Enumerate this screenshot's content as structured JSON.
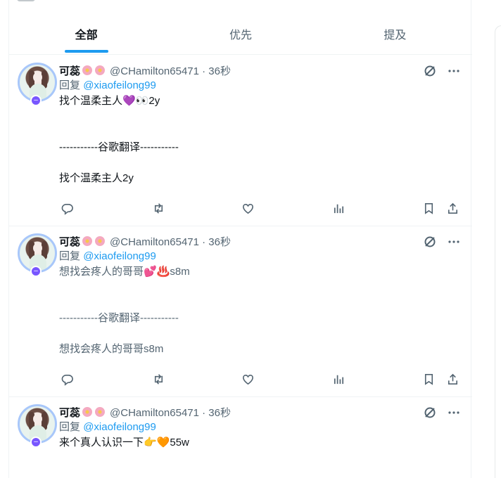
{
  "tabs": [
    {
      "label": "全部",
      "active": true
    },
    {
      "label": "优先",
      "active": false
    },
    {
      "label": "提及",
      "active": false
    }
  ],
  "tweets": [
    {
      "display_name": "可蕊",
      "handle_time": "@CHamilton65471 · 36秒",
      "reply_prefix": "回复",
      "reply_to": "@xiaofeilong99",
      "lines": [
        "找个温柔主人💜👀2y",
        "",
        "",
        "-----------谷歌翻译-----------",
        "",
        "找个温柔主人2y"
      ],
      "text_color": "dark"
    },
    {
      "display_name": "可蕊",
      "handle_time": "@CHamilton65471 · 36秒",
      "reply_prefix": "回复",
      "reply_to": "@xiaofeilong99",
      "lines": [
        "想找会疼人的哥哥💕♨️s8m",
        "",
        "",
        "-----------谷歌翻译-----------",
        "",
        "想找会疼人的哥哥s8m"
      ],
      "text_color": "muted"
    },
    {
      "display_name": "可蕊",
      "handle_time": "@CHamilton65471 · 36秒",
      "reply_prefix": "回复",
      "reply_to": "@xiaofeilong99",
      "lines": [
        "来个真人认识一下👉🧡55w"
      ],
      "text_color": "dark"
    }
  ],
  "icons": {
    "grok": "grok-icon",
    "more": "more-icon",
    "reply": "reply-icon",
    "repost": "repost-icon",
    "like": "like-icon",
    "views": "views-icon",
    "bookmark": "bookmark-icon",
    "share": "share-icon"
  },
  "colors": {
    "accent": "#1d9bf0",
    "badge": "#7856ff",
    "muted": "#536471",
    "text": "#0f1419"
  }
}
